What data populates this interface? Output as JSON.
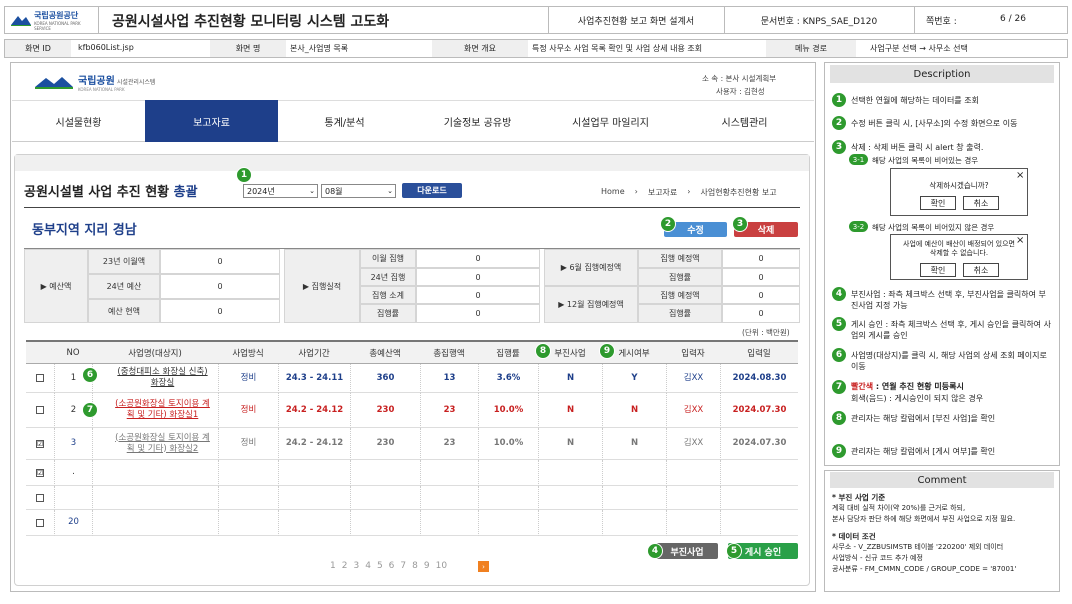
{
  "doc_header": {
    "org_logo": "국립공원공단",
    "org_logo_sub": "KOREA NATIONAL PARK SERVICE",
    "title": "공원시설사업 추진현황 모니터링 시스템 고도화",
    "doc_type": "사업추진현황 보고 화면 설계서",
    "doc_no": "문서번호 : KNPS_SAE_D120",
    "page_label": "쪽번호 :",
    "page_value": "6 / 26"
  },
  "meta": {
    "screen_id_label": "화면 ID",
    "screen_id": "kfb060List.jsp",
    "screen_name_label": "화면 명",
    "screen_name": "본사_사업명 목록",
    "overview_label": "화면 개요",
    "overview": "특정 사무소 사업 목록 확인 및 사업 상세 내용 조회",
    "menu_label": "메뉴 경로",
    "menu": "사업구분 선택 → 사무소 선택"
  },
  "app": {
    "logo": "국립공원",
    "logo_sub": "시설관리시스템",
    "logo_en": "KOREA NATIONAL PARK",
    "affil": "소  속 : 본사 시설계획부",
    "user": "사용자 : 김현성",
    "nav": [
      "시설물현황",
      "보고자료",
      "통계/분석",
      "기술정보 공유방",
      "시설업무 마일리지",
      "시스템관리"
    ],
    "page_title": "공원시설별 사업 추진 현황",
    "page_title_accent": "총괄",
    "year": "2024년",
    "month": "08월",
    "download": "다운로드",
    "breadcrumb": [
      "Home",
      "보고자료",
      "사업현황추진현황 보고"
    ],
    "region": "동부지역 지리 경남",
    "edit_btn": "수정",
    "delete_btn": "삭제",
    "budget_label": "▶ 예산액",
    "budget_rows": [
      {
        "k": "23년 이월액",
        "v": "0"
      },
      {
        "k": "24년 예산",
        "v": "0"
      },
      {
        "k": "예산 현액",
        "v": "0"
      }
    ],
    "exec_label": "▶ 집행실적",
    "exec_rows": [
      {
        "k": "이월 집행",
        "v": "0"
      },
      {
        "k": "24년 집행",
        "v": "0"
      },
      {
        "k": "집행 소계",
        "v": "0"
      },
      {
        "k": "집행률",
        "v": "0"
      }
    ],
    "plan6_label": "▶ 6월 집행예정액",
    "plan12_label": "▶ 12월 집행예정액",
    "plan_rows": [
      {
        "k": "집행 예정액",
        "v": "0"
      },
      {
        "k": "집행률",
        "v": "0"
      },
      {
        "k": "집행 예정액",
        "v": "0"
      },
      {
        "k": "집행률",
        "v": "0"
      }
    ],
    "unit": "(단위 : 백만원)",
    "table_headers": [
      "NO",
      "사업명(대상지)",
      "사업방식",
      "사업기간",
      "총예산액",
      "총집행액",
      "집행률",
      "부진사업",
      "게시여부",
      "입력자",
      "입력일"
    ],
    "rows": [
      {
        "check": "",
        "no": "1",
        "name": "(중청대피소 화장실 신축) 화장실",
        "method": "정비",
        "period": "24.3 - 24.11",
        "budget": "360",
        "exec": "13",
        "rate": "3.6%",
        "poor": "N",
        "post": "Y",
        "user": "김XX",
        "date": "2024.08.30"
      },
      {
        "check": "",
        "no": "2",
        "name": "(소공원화장실 토지이용 계획 및 기타) 화장실1",
        "method": "정비",
        "period": "24.2 - 24.12",
        "budget": "230",
        "exec": "23",
        "rate": "10.0%",
        "poor": "N",
        "post": "N",
        "user": "김XX",
        "date": "2024.07.30"
      },
      {
        "check": "☑",
        "no": "3",
        "name": "(소공원화장실 토지이용 계획 및 기타) 화장실2",
        "method": "정비",
        "period": "24.2 - 24.12",
        "budget": "230",
        "exec": "23",
        "rate": "10.0%",
        "poor": "N",
        "post": "N",
        "user": "김XX",
        "date": "2024.07.30"
      },
      {
        "check": "☑",
        "no": ".",
        "name": "",
        "method": "",
        "period": "",
        "budget": "",
        "exec": "",
        "rate": "",
        "poor": "",
        "post": "",
        "user": "",
        "date": ""
      },
      {
        "check": "",
        "no": "",
        "name": "",
        "method": "",
        "period": "",
        "budget": "",
        "exec": "",
        "rate": "",
        "poor": "",
        "post": "",
        "user": "",
        "date": ""
      },
      {
        "check": "",
        "no": "20",
        "name": "",
        "method": "",
        "period": "",
        "budget": "",
        "exec": "",
        "rate": "",
        "poor": "",
        "post": "",
        "user": "",
        "date": ""
      }
    ],
    "pages": [
      "1",
      "2",
      "3",
      "4",
      "5",
      "6",
      "7",
      "8",
      "9",
      "10"
    ],
    "poor_btn": "부진사업",
    "post_btn": "게시 승인"
  },
  "desc": {
    "title": "Description",
    "d1": "선택한 연월에 해당하는 데이터를 조회",
    "d2": "수정 버튼 클릭 시, [사무소]의 수정 화면으로 이동",
    "d3": "삭제 : 삭제 버튼 클릭 시 alert 창 출력.",
    "d31": "해당 사업의 목록이 비어있는 경우",
    "alert1": "삭제하시겠습니까?",
    "d32": "해당 사업의 목록이 비어있지 않은 경우",
    "alert2": "사업에 예산이 배산이 배정되어 있으면 삭제할 수 없습니다.",
    "ok": "확인",
    "cancel": "취소",
    "d4": "부진사업 : 좌측 체크박스 선택 후, 부진사업을 클릭하여 부진사업 지정 가능",
    "d5": "게시 승인 : 좌측 체크박스 선택 후, 게시 승인을 클릭하여 사업의 게시를 승인",
    "d6": "사업명(대상지)를 클릭 시, 해당 사업의 상세 조회 페이지로 이동",
    "d7a": "빨간색",
    "d7b": ": 연월 추진 현황 미등록시",
    "d7c": "회색(음드) : 게시승인이 되지 않은 경우",
    "d8": "관리자는 해당 칼럼에서 [부진 사업]을 확인",
    "d9": "관리자는 해당 칼럼에서 [게시 여부]를 확인"
  },
  "comment": {
    "title": "Comment",
    "c1": "* 부진 사업 기준",
    "c1a": "계획 대비 실적 차이(약 20%)를 근거로 하되,",
    "c1b": "본사 담당자 판단 하에 해당 화면에서 부진 사업으로 지정 필요.",
    "c2": "* 데이터 조건",
    "c2a": "사무소 - V_ZZBUSIMSTB 테이블 '220200' 제외 데이터",
    "c2b": "사업방식 - 신규 코드 추가 예정",
    "c2c": "공사분류 - FM_CMMN_CODE / GROUP_CODE = '87001'"
  },
  "colors": {
    "nav_active": "#1e3f8a",
    "accent_green": "#2e9a2e",
    "edit": "#4a8fd4",
    "delete": "#c94040",
    "download": "#2a4f9a",
    "red_text": "#c82020"
  }
}
